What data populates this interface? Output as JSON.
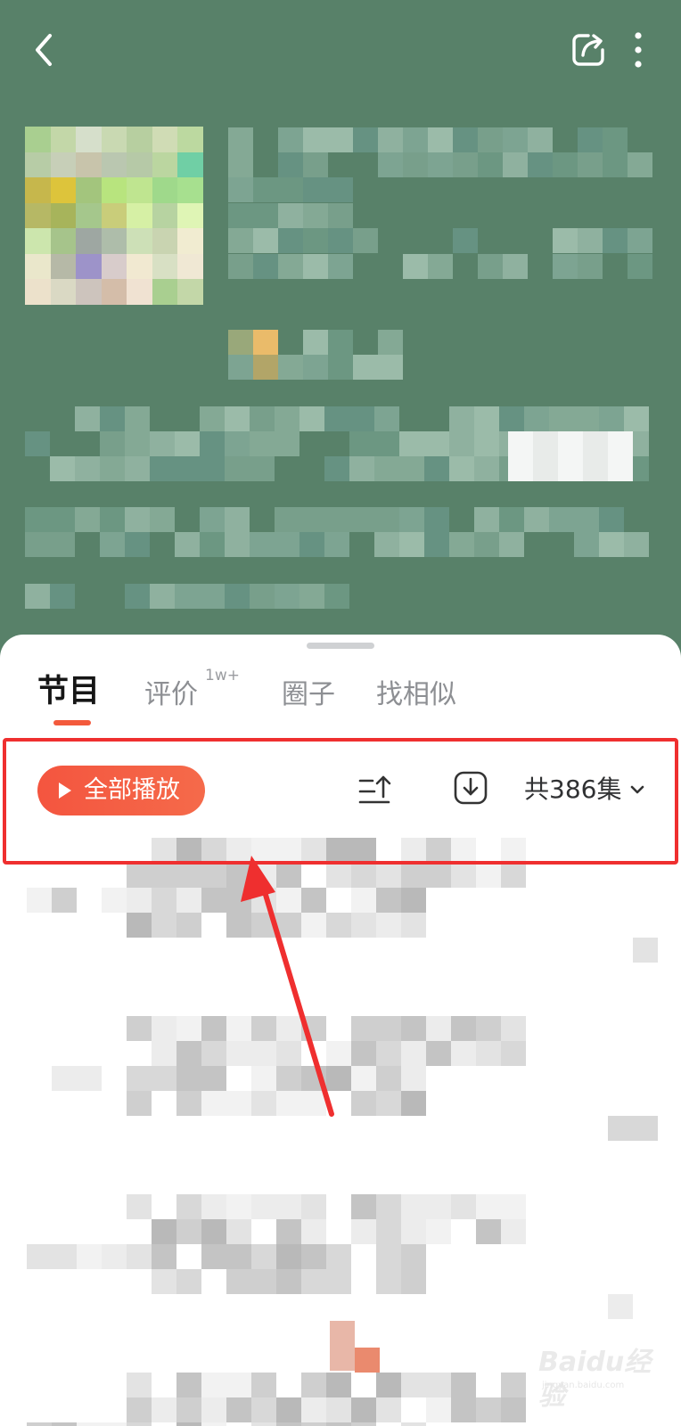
{
  "header": {
    "background_color": "#588169",
    "icons": {
      "back": "chevron-left-icon",
      "share": "share-icon",
      "more": "more-vertical-icon"
    }
  },
  "tabs": [
    {
      "label": "节目"
    },
    {
      "label": "评价"
    },
    {
      "label": "圈子"
    },
    {
      "label": "找相似"
    }
  ],
  "tab_badge": "1w+",
  "toolbar": {
    "play_all_label": "全部播放",
    "sort_icon": "sort-ascending-icon",
    "download_icon": "download-icon",
    "episode_count_label": "共386集"
  },
  "watermark": {
    "brand": "Baidu经验",
    "sub": "jingyan.baidu.com"
  },
  "colors": {
    "accent": "#f35a3c",
    "annotation": "#ef2f2f"
  }
}
